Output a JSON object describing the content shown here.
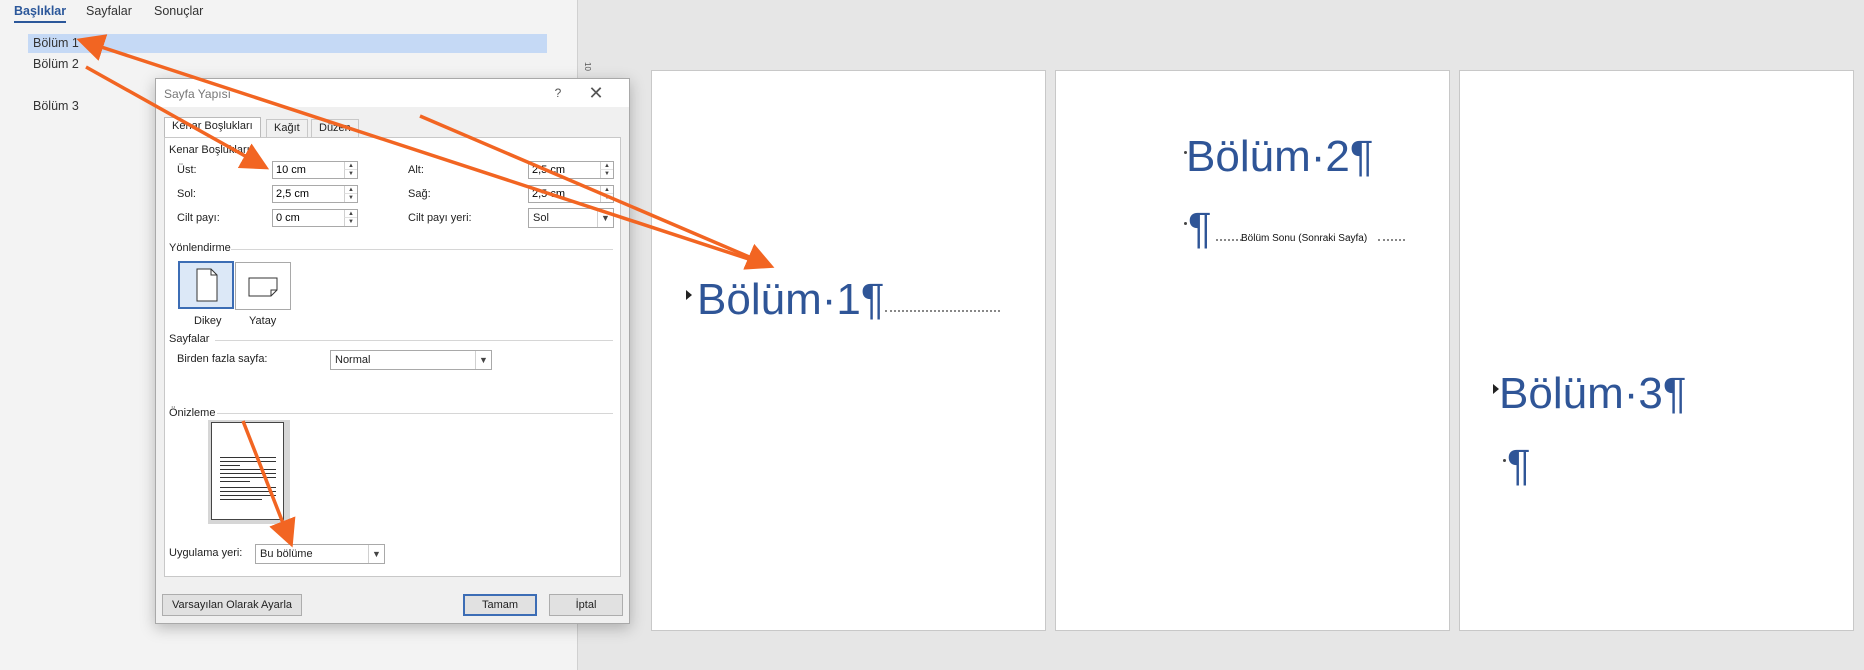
{
  "nav_pane": {
    "tabs": [
      {
        "label": "Başlıklar",
        "active": true
      },
      {
        "label": "Sayfalar",
        "active": false
      },
      {
        "label": "Sonuçlar",
        "active": false
      }
    ],
    "headings": [
      {
        "label": "Bölüm 1",
        "selected": true
      },
      {
        "label": "Bölüm 2",
        "selected": false
      },
      {
        "label": "Bölüm 3",
        "selected": false
      }
    ]
  },
  "ruler": {
    "mark": "10"
  },
  "document": {
    "page1": {
      "heading": "Bölüm·1¶"
    },
    "page2": {
      "heading": "Bölüm·2¶",
      "para_mark": "¶",
      "section_break": "Bölüm Sonu (Sonraki Sayfa)"
    },
    "page3": {
      "heading": "Bölüm·3¶",
      "para_mark": "¶"
    }
  },
  "dialog": {
    "title": "Sayfa Yapısı",
    "help_label": "?",
    "close_label": "✕",
    "tabs": [
      {
        "label": "Kenar Boşlukları",
        "active": true
      },
      {
        "label": "Kağıt",
        "active": false
      },
      {
        "label": "Düzen",
        "active": false
      }
    ],
    "margins": {
      "group_label": "Kenar Boşlukları",
      "top_label": "Üst:",
      "top_value": "10 cm",
      "bottom_label": "Alt:",
      "bottom_value": "2,5 cm",
      "left_label": "Sol:",
      "left_value": "2,5 cm",
      "right_label": "Sağ:",
      "right_value": "2,5 cm",
      "gutter_label": "Cilt payı:",
      "gutter_value": "0 cm",
      "gutter_pos_label": "Cilt payı yeri:",
      "gutter_pos_value": "Sol"
    },
    "orientation": {
      "group_label": "Yönlendirme",
      "portrait_label": "Dikey",
      "landscape_label": "Yatay",
      "selected": "portrait"
    },
    "pages": {
      "group_label": "Sayfalar",
      "multiple_label": "Birden fazla sayfa:",
      "multiple_value": "Normal"
    },
    "preview": {
      "group_label": "Önizleme",
      "apply_label": "Uygulama yeri:",
      "apply_value": "Bu bölüme"
    },
    "buttons": {
      "default_label": "Varsayılan Olarak Ayarla",
      "ok_label": "Tamam",
      "cancel_label": "İptal"
    }
  },
  "colors": {
    "heading_blue": "#2f5597",
    "annotation_orange": "#f26522",
    "nav_selected": "#c5d9f5",
    "accent": "#2b579a"
  }
}
